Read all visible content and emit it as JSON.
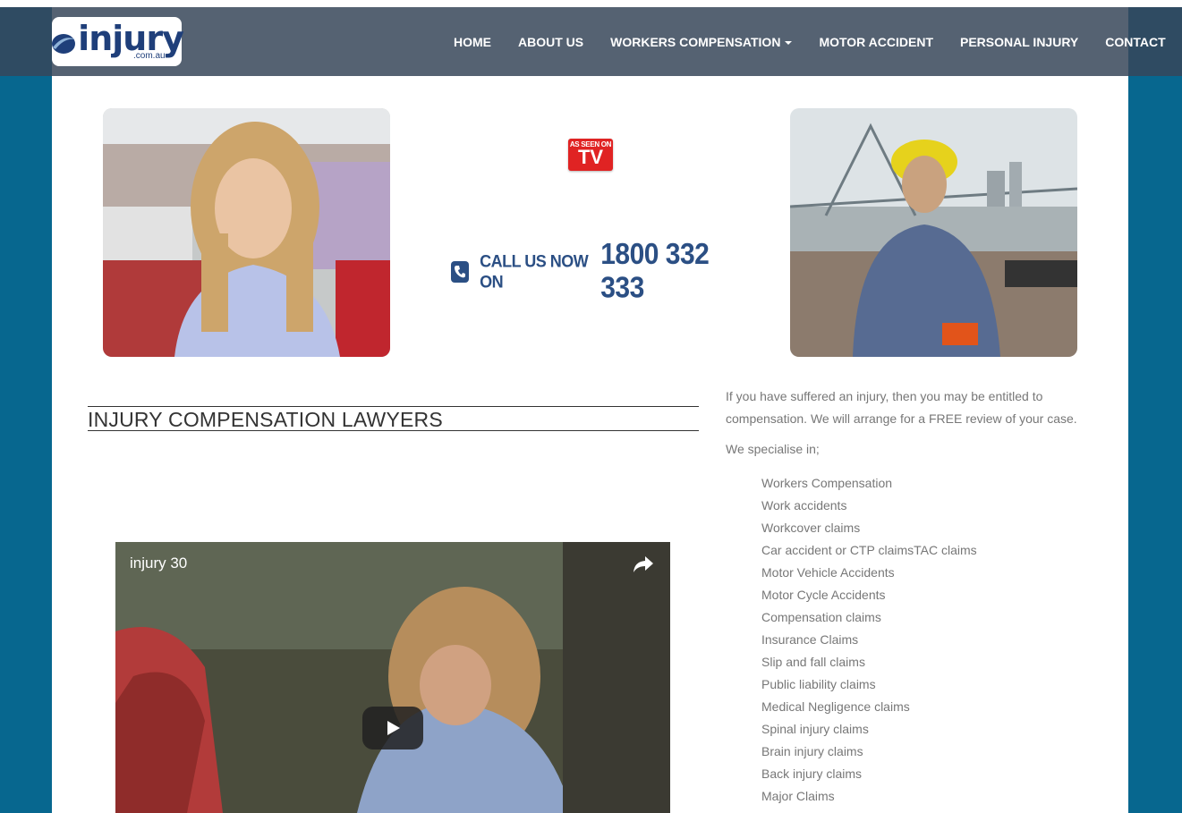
{
  "brand": {
    "name": "injury",
    "domain": ".com.au"
  },
  "nav": {
    "items": [
      "HOME",
      "ABOUT US",
      "WORKERS COMPENSATION",
      "MOTOR ACCIDENT",
      "PERSONAL INJURY",
      "CONTACT"
    ]
  },
  "hero": {
    "tv_badge_top": "AS SEEN ON",
    "tv_badge_main": "TV",
    "call_label": "CALL US NOW ON",
    "call_number": "1800 332 333"
  },
  "main": {
    "heading": "INJURY COMPENSATION LAWYERS",
    "video": {
      "title": "injury 30"
    }
  },
  "sidebar": {
    "intro": "If you have suffered an injury, then you may be entitled to compensation. We will arrange for a FREE review of your case.",
    "specialise_label": "We specialise in;",
    "items": [
      "Workers Compensation",
      "Work accidents",
      "Workcover claims",
      "Car accident or CTP claimsTAC claims",
      "Motor Vehicle Accidents",
      "Motor Cycle Accidents",
      "Compensation claims",
      "Insurance Claims",
      "Slip and fall claims",
      "Public liability claims",
      "Medical Negligence claims",
      "Spinal injury claims",
      "Brain injury claims",
      "Back injury claims",
      "Major Claims"
    ]
  },
  "colors": {
    "page_bg": "#07678f",
    "navbar": "#556272",
    "brand_blue": "#2b4f84",
    "tv_red": "#e02323"
  }
}
